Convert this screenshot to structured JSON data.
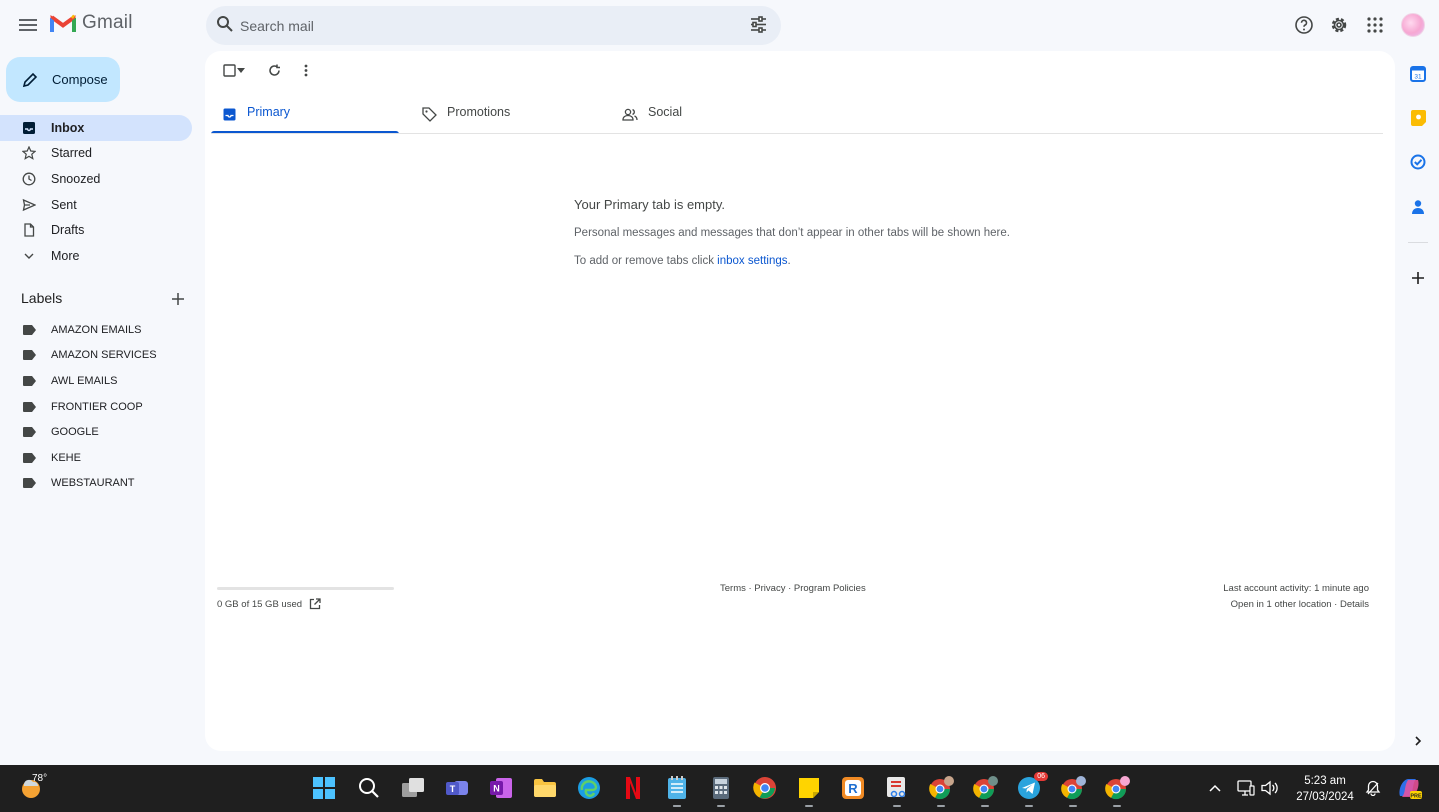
{
  "header": {
    "app_name": "Gmail",
    "search_placeholder": "Search mail"
  },
  "sidebar": {
    "compose_label": "Compose",
    "items": [
      {
        "label": "Inbox",
        "icon": "inbox-icon"
      },
      {
        "label": "Starred",
        "icon": "star-icon"
      },
      {
        "label": "Snoozed",
        "icon": "clock-icon"
      },
      {
        "label": "Sent",
        "icon": "send-icon"
      },
      {
        "label": "Drafts",
        "icon": "draft-icon"
      },
      {
        "label": "More",
        "icon": "chevron-down-icon"
      }
    ],
    "labels_heading": "Labels",
    "labels": [
      "AMAZON EMAILS",
      "AMAZON SERVICES",
      "AWL EMAILS",
      "FRONTIER COOP",
      "GOOGLE",
      "KEHE",
      "WEBSTAURANT"
    ]
  },
  "tabs": [
    {
      "label": "Primary",
      "icon": "inbox-tab-icon"
    },
    {
      "label": "Promotions",
      "icon": "tag-icon"
    },
    {
      "label": "Social",
      "icon": "people-icon"
    }
  ],
  "empty_state": {
    "title": "Your Primary tab is empty.",
    "line1": "Personal messages and messages that don’t appear in other tabs will be shown here.",
    "line2_prefix": "To add or remove tabs click ",
    "line2_link": "inbox settings",
    "line2_suffix": "."
  },
  "footer": {
    "storage_text": "0 GB of 15 GB used",
    "storage_fraction": 0,
    "links": "Terms · Privacy · Program Policies",
    "activity_line1": "Last account activity: 1 minute ago",
    "activity_line2": "Open in 1 other location · Details"
  },
  "taskbar": {
    "weather_temp": "78°",
    "telegram_badge": "06",
    "time": "5:23 am",
    "date": "27/03/2024"
  },
  "colors": {
    "accent": "#0b57d0",
    "compose_bg": "#c2e7ff",
    "active_nav_bg": "#d3e3fd",
    "page_bg": "#f6f8fc"
  }
}
